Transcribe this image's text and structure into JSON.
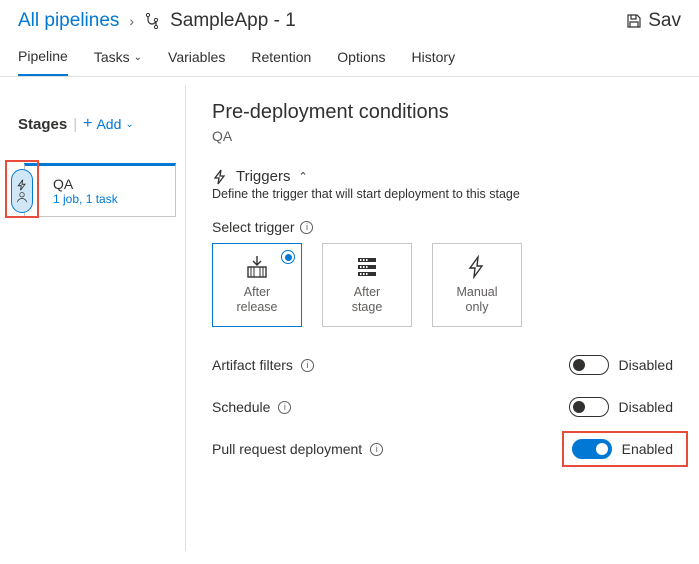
{
  "breadcrumb": {
    "root": "All pipelines",
    "title": "SampleApp - 1",
    "save_label": "Sav"
  },
  "tabs": {
    "pipeline": "Pipeline",
    "tasks": "Tasks",
    "variables": "Variables",
    "retention": "Retention",
    "options": "Options",
    "history": "History"
  },
  "stages": {
    "header": "Stages",
    "add": "Add",
    "card": {
      "name": "QA",
      "meta": "1 job, 1 task"
    }
  },
  "panel": {
    "title": "Pre-deployment conditions",
    "stage": "QA",
    "triggers_header": "Triggers",
    "triggers_desc": "Define the trigger that will start deployment to this stage",
    "select_trigger": "Select trigger",
    "options": {
      "after_release": "After\nrelease",
      "after_stage": "After\nstage",
      "manual_only": "Manual\nonly"
    },
    "artifact_filters": "Artifact filters",
    "schedule": "Schedule",
    "pull_request": "Pull request deployment",
    "disabled": "Disabled",
    "enabled": "Enabled"
  }
}
